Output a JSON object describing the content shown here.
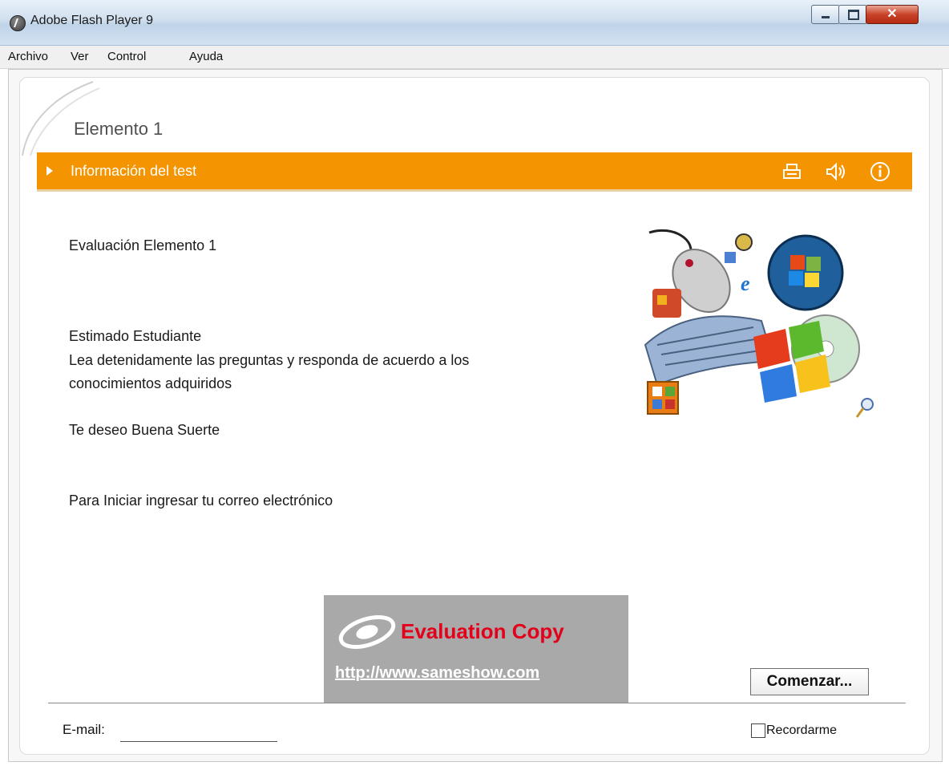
{
  "window": {
    "title": "Adobe Flash Player 9"
  },
  "menu": {
    "items": [
      "Archivo",
      "Ver",
      "Control",
      "Ayuda"
    ]
  },
  "page": {
    "heading": "Elemento 1",
    "section_bar": {
      "title": "Información del test",
      "icons": [
        "print-icon",
        "speaker-icon",
        "info-icon"
      ]
    },
    "evaluation_title": "Evaluación Elemento 1",
    "greeting": "Estimado Estudiante",
    "instructions_line1": "Lea detenidamente las preguntas y responda de acuerdo a los",
    "instructions_line2": "conocimientos adquiridos",
    "wish": "Te deseo Buena Suerte",
    "start_prompt": "Para Iniciar ingresar tu correo electrónico"
  },
  "watermark": {
    "title": "Evaluation Copy",
    "url": "http://www.sameshow.com"
  },
  "form": {
    "start_button": "Comenzar...",
    "email_label": "E-mail:",
    "email_value": "",
    "remember_label": "Recordarme",
    "remember_checked": false
  },
  "colors": {
    "accent": "#f39400",
    "watermark_red": "#e2001a"
  }
}
